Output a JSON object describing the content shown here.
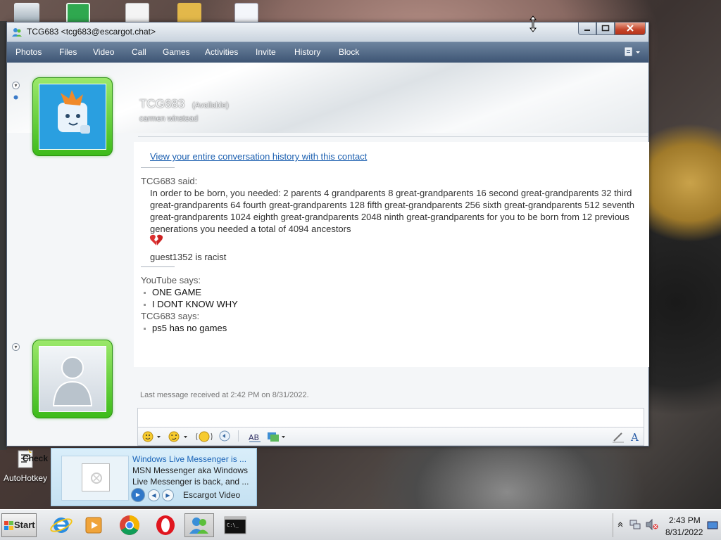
{
  "window": {
    "title": "TCG683 <tcg683@escargot.chat>"
  },
  "menu": {
    "items": [
      "Photos",
      "Files",
      "Video",
      "Call",
      "Games",
      "Activities",
      "Invite",
      "History",
      "Block"
    ]
  },
  "contact": {
    "name": "TCG683",
    "status": "(Available)",
    "personal_message": "carmen winstead"
  },
  "conversation": {
    "history_link": "View your entire conversation history with this contact",
    "blocks": [
      {
        "speaker": "TCG683 said:",
        "text": "In order to be born, you needed: 2 parents 4 grandparents 8 great-grandparents 16 second great-grandparents 32 third great-grandparents 64 fourth great-grandparents 128 fifth great-grandparents 256 sixth great-grandparents 512 seventh great-grandparents 1024 eighth great-grandparents 2048 ninth great-grandparents for you to be born from 12 previous generations you needed a total of 4094 ancestors",
        "followup": "guest1352 is racist"
      }
    ],
    "youtube": {
      "speaker": "YouTube says:",
      "lines": [
        "ONE GAME",
        "I DONT KNOW WHY"
      ]
    },
    "tcg": {
      "speaker": "TCG683 says:",
      "lines": [
        "ps5 has no games"
      ]
    }
  },
  "footer": {
    "last_message": "Last message received at 2:42 PM on 8/31/2022.",
    "forum": "Check out our new forum!"
  },
  "toast": {
    "title": "Windows Live Messenger is ...",
    "body": "MSN Messenger aka Windows Live Messenger is back, and ...",
    "video_label": "Escargot Video"
  },
  "desktop": {
    "autohotkey_label": "AutoHotkey"
  },
  "taskbar": {
    "start_label": "Start",
    "time": "2:43 PM",
    "date": "8/31/2022"
  },
  "colors": {
    "menubar": "#4d6584",
    "link": "#1b5fb0",
    "avatar_frame": "#3dbb1a"
  }
}
